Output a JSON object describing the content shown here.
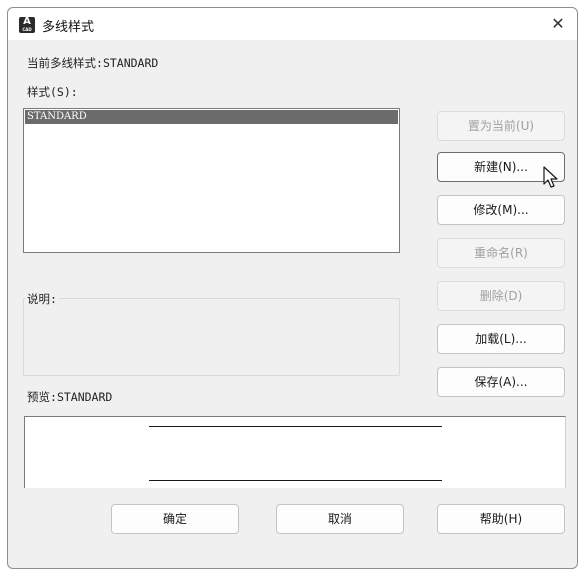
{
  "window": {
    "title": "多线样式",
    "app_icon_letter": "A",
    "app_icon_sub": "CAD",
    "close_glyph": "✕"
  },
  "current_style": {
    "label": "当前多线样式:",
    "value": "STANDARD"
  },
  "styles": {
    "label": "样式(S):",
    "items": [
      "STANDARD"
    ],
    "selected": "STANDARD"
  },
  "buttons": {
    "set_current": "置为当前(U)",
    "new": "新建(N)...",
    "modify": "修改(M)...",
    "rename": "重命名(R)",
    "delete": "删除(D)",
    "load": "加载(L)...",
    "save": "保存(A)..."
  },
  "description": {
    "label": "说明:"
  },
  "preview": {
    "label": "预览:",
    "value": "STANDARD"
  },
  "footer": {
    "ok": "确定",
    "cancel": "取消",
    "help": "帮助(H)"
  },
  "colors": {
    "selection": "#6b6b6b",
    "dialog_bg": "#f0f0f0",
    "disabled_text": "#a0a0a0"
  }
}
